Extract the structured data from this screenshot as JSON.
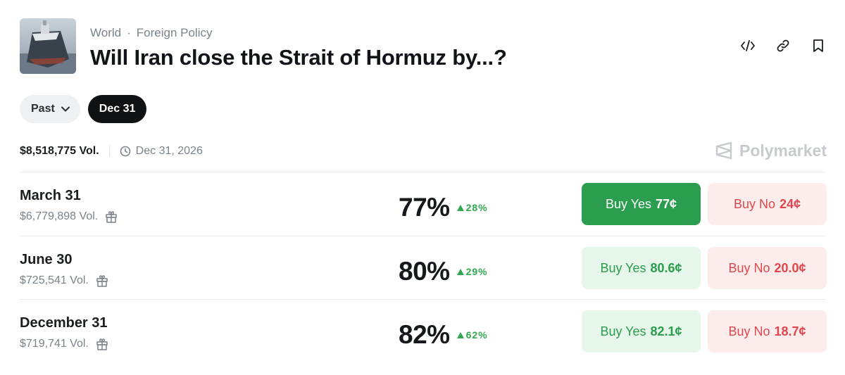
{
  "header": {
    "breadcrumb": [
      "World",
      "Foreign Policy"
    ],
    "breadcrumb_separator": "·",
    "title": "Will Iran close the Strait of Hormuz by...?",
    "actions": [
      "embed-icon",
      "link-icon",
      "bookmark-icon"
    ]
  },
  "filters": {
    "past_label": "Past",
    "selected_label": "Dec 31"
  },
  "meta": {
    "total_volume": "$8,518,775 Vol.",
    "end_date": "Dec 31, 2026",
    "brand": "Polymarket"
  },
  "markets": [
    {
      "label": "March 31",
      "volume": "$6,779,898 Vol.",
      "percent": "77%",
      "change": "28%",
      "yes_label": "Buy Yes",
      "yes_price": "77¢",
      "no_label": "Buy No",
      "no_price": "24¢",
      "yes_active": true
    },
    {
      "label": "June 30",
      "volume": "$725,541 Vol.",
      "percent": "80%",
      "change": "29%",
      "yes_label": "Buy Yes",
      "yes_price": "80.6¢",
      "no_label": "Buy No",
      "no_price": "20.0¢",
      "yes_active": false
    },
    {
      "label": "December 31",
      "volume": "$719,741 Vol.",
      "percent": "82%",
      "change": "62%",
      "yes_label": "Buy Yes",
      "yes_price": "82.1¢",
      "no_label": "Buy No",
      "no_price": "18.7¢",
      "yes_active": false
    }
  ],
  "colors": {
    "yes_active_bg": "#2a9d4f",
    "yes_soft_bg": "#e7f6ea",
    "no_bg": "#fdecec",
    "no_text": "#e0474c",
    "change_up": "#2fa84f"
  }
}
